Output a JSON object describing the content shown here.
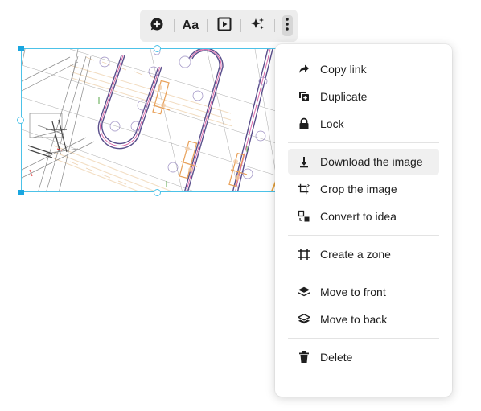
{
  "toolbar": {
    "text_button_label": "Aa",
    "icons": [
      "add-comment-icon",
      "text-format-icon",
      "present-icon",
      "ai-sparkle-icon",
      "more-vertical-icon"
    ]
  },
  "menu": {
    "items": [
      {
        "label": "Copy link",
        "icon": "share-arrow-icon"
      },
      {
        "label": "Duplicate",
        "icon": "duplicate-icon"
      },
      {
        "label": "Lock",
        "icon": "lock-icon"
      },
      {
        "label": "Download the image",
        "icon": "download-icon"
      },
      {
        "label": "Crop the image",
        "icon": "crop-icon"
      },
      {
        "label": "Convert to idea",
        "icon": "convert-icon"
      },
      {
        "label": "Create a zone",
        "icon": "zone-icon"
      },
      {
        "label": "Move to front",
        "icon": "bring-front-icon"
      },
      {
        "label": "Move to back",
        "icon": "send-back-icon"
      },
      {
        "label": "Delete",
        "icon": "trash-icon"
      }
    ],
    "highlighted": "Download the image"
  },
  "colors": {
    "selection": "#4cc2e8",
    "handle": "#19a6e0",
    "toolbar_bg": "#ededed",
    "hover_bg": "#f0f0f0"
  }
}
